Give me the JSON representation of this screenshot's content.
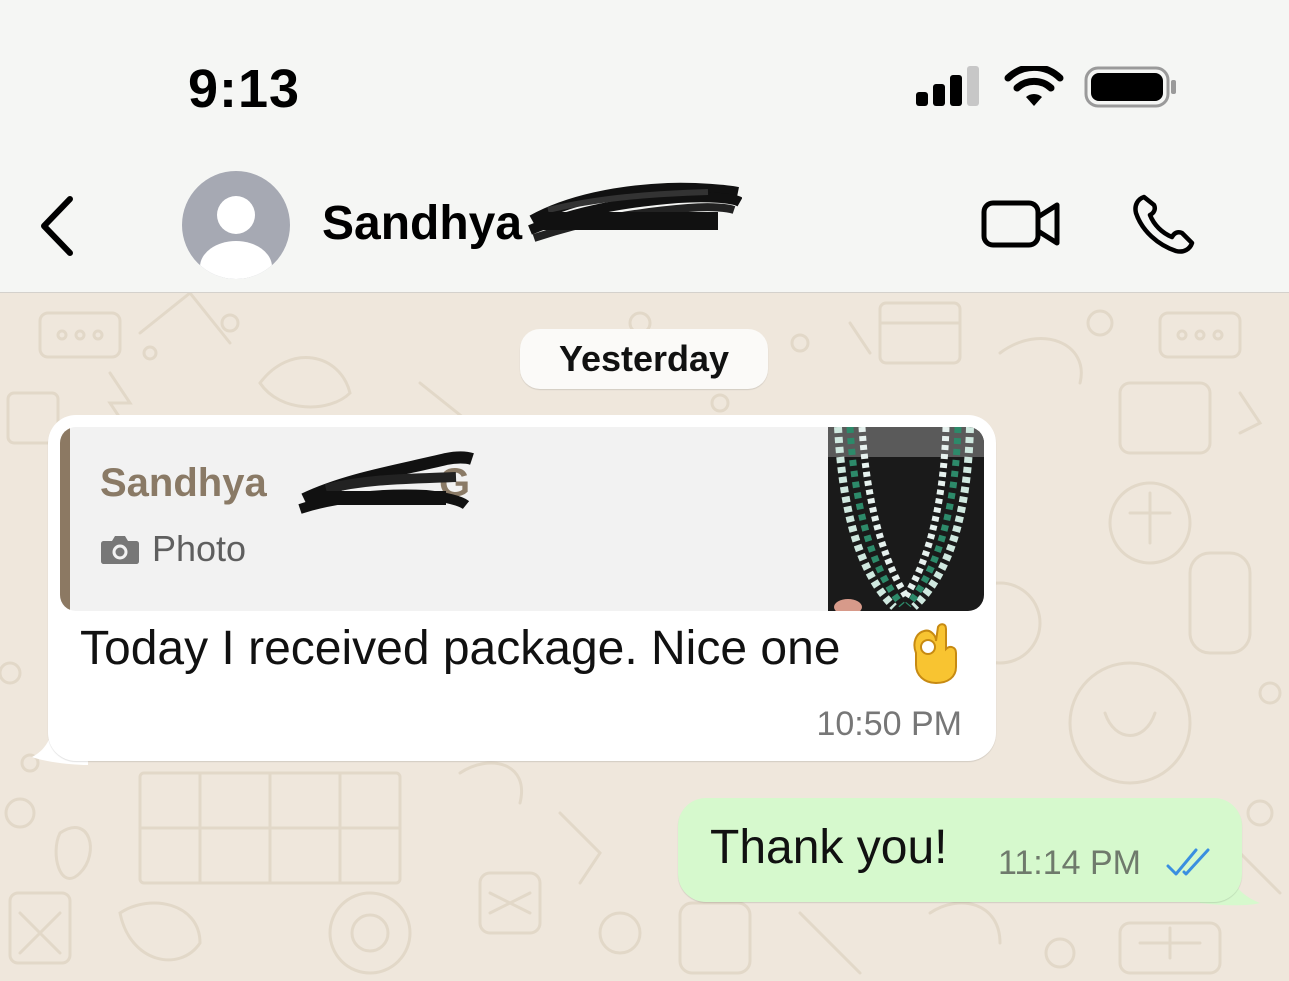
{
  "status_bar": {
    "time": "9:13"
  },
  "header": {
    "contact_name": "Sandhya",
    "back_icon": "chevron-left-icon",
    "video_icon": "video-camera-icon",
    "call_icon": "phone-icon",
    "avatar_icon": "default-person-icon"
  },
  "chat": {
    "date_label": "Yesterday",
    "messages": [
      {
        "direction": "incoming",
        "reply_to": {
          "author": "Sandhya",
          "author_suffix": "G",
          "type_label": "Photo",
          "type_icon": "camera-icon"
        },
        "text": "Today I received package. Nice one",
        "emoji": "👌",
        "time": "10:50 PM"
      },
      {
        "direction": "outgoing",
        "text": "Thank you!",
        "time": "11:14 PM",
        "status": "read",
        "status_icon": "double-check-icon"
      }
    ]
  },
  "colors": {
    "header_bg": "#f5f6f4",
    "chat_bg": "#efe7dc",
    "incoming_bubble": "#ffffff",
    "outgoing_bubble": "#d6f9cd",
    "quote_bar": "#8c7963",
    "read_ticks": "#3a8fe0"
  }
}
